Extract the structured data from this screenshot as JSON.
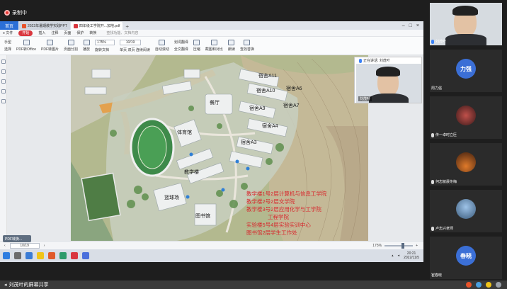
{
  "recording": {
    "label": "录制中"
  },
  "browser": {
    "home_tab": "首页",
    "tabs": [
      {
        "label": "2022年暑期教学实践PPT",
        "active": false
      },
      {
        "label": "四年级工学院开...加地.pdf",
        "active": true
      }
    ],
    "add_tab": "+"
  },
  "menu": {
    "items": [
      "≡ 文件",
      "开始",
      "插入",
      "注释",
      "页面",
      "保护",
      "转换"
    ],
    "start_label": "开始",
    "search": "查找功能、文档内容"
  },
  "toolbar": {
    "hand_label": "手型",
    "select_label": "选择",
    "pdf_to_word": "PDF转Office",
    "pdf_to_img": "PDF转图片",
    "play": "播放",
    "page_split": "页面分割",
    "zoom_value": "175%",
    "rotate": "旋转文档",
    "single": "单页",
    "double": "双页",
    "continuous": "连续阅读",
    "page_value": "10/19",
    "auto_scroll": "自动滚动",
    "highlight": "划词翻译",
    "fulltext": "全文翻译",
    "compress": "压缩",
    "screenshot": "截图和对比",
    "read_aloud": "朗读",
    "find_replace": "查找替换"
  },
  "status": {
    "page": "10/19",
    "zoom": "175%"
  },
  "taskbar": {
    "time": "20:21",
    "date": "2022/11/5"
  },
  "speaker_window": {
    "label": "正在讲话: 刘茂叶",
    "name": "刘茂叶"
  },
  "participants": [
    {
      "name": "刘茂叶",
      "initials": "",
      "color": "#556677"
    },
    {
      "name": "周力强",
      "initials": "力强",
      "color": "#3b6fd6"
    },
    {
      "name": "传一卓时立臣",
      "initials": "",
      "color": "#5a3030"
    },
    {
      "name": "何志敏晨冬梅",
      "initials": "",
      "color": "#7a4020"
    },
    {
      "name": "卢志兴老师",
      "initials": "",
      "color": "#4a6a8a"
    },
    {
      "name": "崔春晓",
      "initials": "春晓",
      "color": "#3b6fd6"
    }
  ],
  "map": {
    "labels": {
      "dorm_a11": "宿舍A11",
      "dorm_a10": "宿舍A10",
      "dorm_a6": "宿舍A6",
      "dorm_a9": "宿舍A9",
      "dorm_a7": "宿舍A7",
      "dorm_a4": "宿舍A4",
      "dorm_a3": "宿舍A3",
      "canteen": "餐厅",
      "gym": "体育馆",
      "teach_b": "教学楼",
      "court": "篮球场",
      "library": "图书馆",
      "lab": "实验楼"
    },
    "red_lines": [
      "教学楼1号2层计算机与信息工学院",
      "教学楼2号2层文学院",
      "教学楼3号2层应用化学与工学院",
      "工程学院",
      "实验楼5号4层实验实训中心",
      "图书馆2层学生工作处"
    ]
  },
  "minimized": "PDF转换...",
  "share_bar": {
    "label": "刘茂叶的屏幕共享"
  }
}
